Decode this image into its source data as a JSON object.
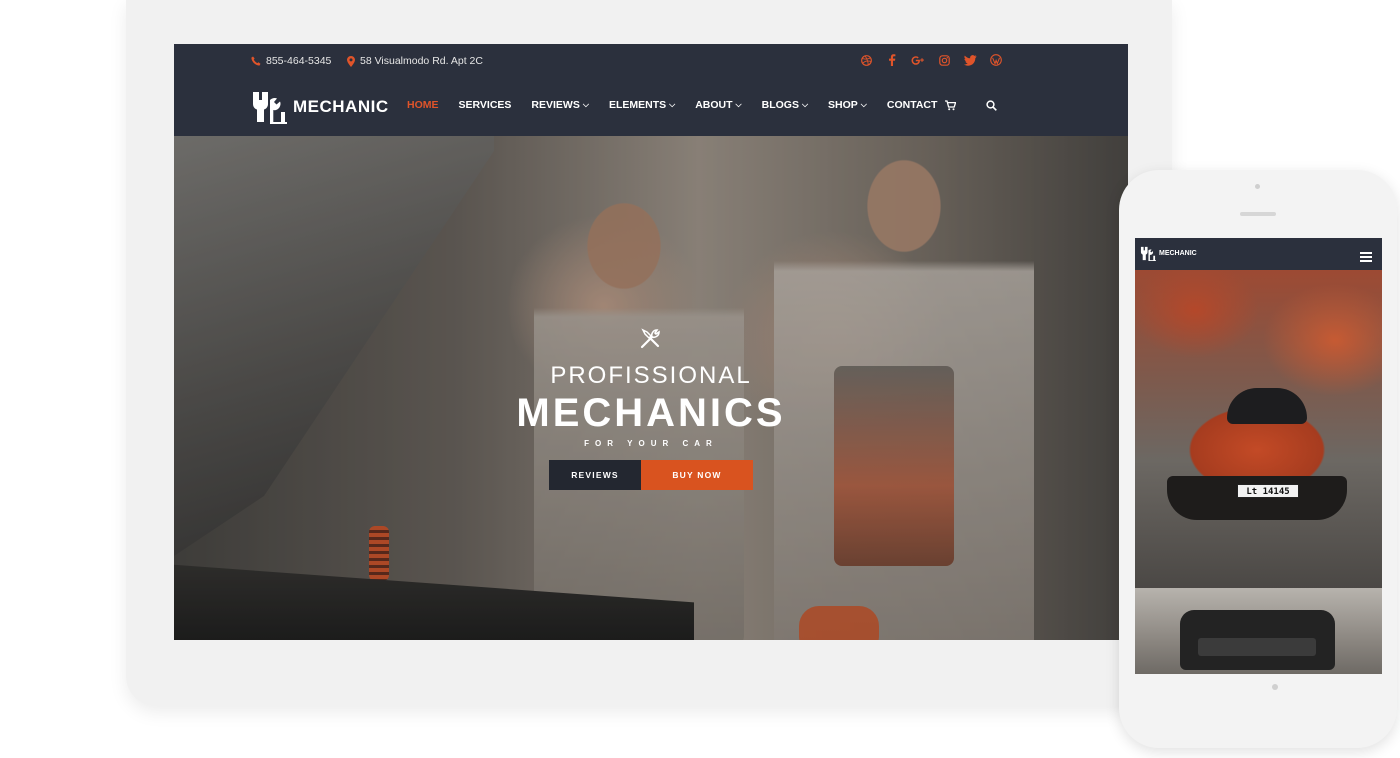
{
  "colors": {
    "navy": "#2b303d",
    "accent": "#e0542a",
    "button_dark": "#232730",
    "button_orange": "#d9531f",
    "frame": "#f1f1f1"
  },
  "topbar": {
    "phone": "855-464-5345",
    "phone_icon": "phone-icon",
    "address": "58 Visualmodo Rd. Apt 2C",
    "address_icon": "map-marker-icon",
    "social_icons": [
      "dribbble-icon",
      "facebook-icon",
      "google-plus-icon",
      "instagram-icon",
      "twitter-icon",
      "wordpress-icon"
    ]
  },
  "logo": {
    "text": "MECHANIC",
    "icon": "wrench-logo-icon"
  },
  "nav": {
    "items": [
      {
        "label": "HOME",
        "active": true,
        "dropdown": false
      },
      {
        "label": "SERVICES",
        "active": false,
        "dropdown": false
      },
      {
        "label": "REVIEWS",
        "active": false,
        "dropdown": true
      },
      {
        "label": "ELEMENTS",
        "active": false,
        "dropdown": true
      },
      {
        "label": "ABOUT",
        "active": false,
        "dropdown": true
      },
      {
        "label": "BLOGS",
        "active": false,
        "dropdown": true
      },
      {
        "label": "SHOP",
        "active": false,
        "dropdown": true
      },
      {
        "label": "CONTACT",
        "active": false,
        "dropdown": false
      }
    ],
    "cart_icon": "cart-icon",
    "search_icon": "search-icon"
  },
  "hero": {
    "icon": "tools-icon",
    "pre_title": "PROFISSIONAL",
    "title": "MECHANICS",
    "subtitle": "FOR YOUR CAR",
    "buttons": {
      "reviews": "REVIEWS",
      "buy_now": "BUY NOW"
    }
  },
  "mobile": {
    "logo_text": "MECHANIC",
    "menu_icon": "hamburger-menu-icon",
    "plate_text": "Lt 14145"
  }
}
